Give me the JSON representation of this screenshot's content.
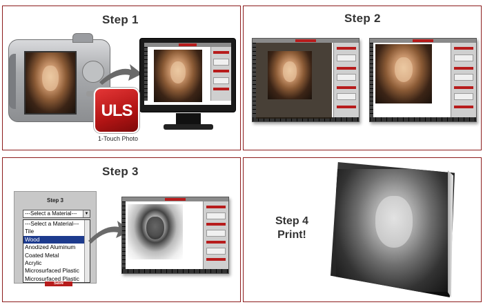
{
  "panels": {
    "step1": {
      "title": "Step 1",
      "logo_text": "ULS",
      "logo_caption": "1-Touch Photo"
    },
    "step2": {
      "title": "Step 2"
    },
    "step3": {
      "title": "Step 3",
      "material_panel": {
        "title": "Step 3",
        "selected": "---Select a Material---",
        "options": [
          "---Select a Material---",
          "Tile",
          "Wood",
          "Anodized Aluminum",
          "Coated Metal",
          "Acrylic",
          "Microsurfaced Plastic",
          "Microsurfaced Plastic"
        ],
        "highlighted": "Wood",
        "save_label": "Save"
      }
    },
    "step4": {
      "title_line1": "Step 4",
      "title_line2": "Print!"
    }
  },
  "colors": {
    "border": "#8b1a1a",
    "accent_red": "#b71c1c",
    "highlight": "#1d3b8e"
  }
}
